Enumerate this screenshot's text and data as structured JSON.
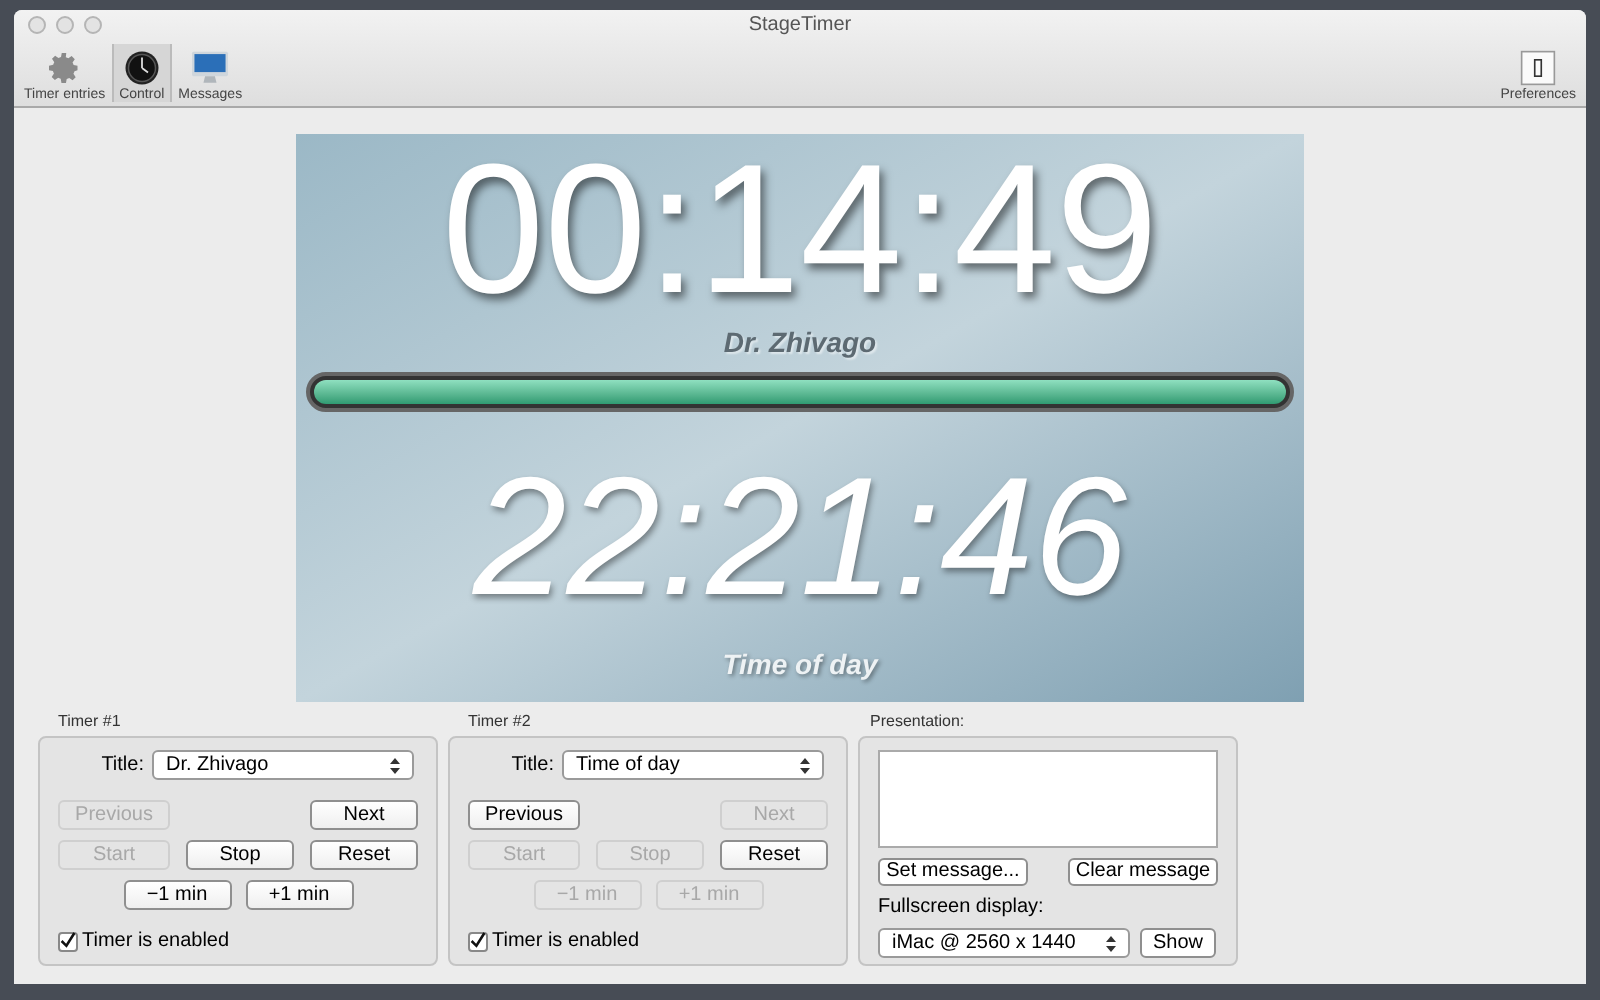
{
  "window": {
    "title": "StageTimer"
  },
  "toolbar": [
    {
      "label": "Timer entries",
      "kind": "gear",
      "selected": false
    },
    {
      "label": "Control",
      "kind": "clock",
      "selected": true
    },
    {
      "label": "Messages",
      "kind": "monitor",
      "selected": false
    },
    {
      "label": "Preferences",
      "kind": "switch",
      "selected": false
    }
  ],
  "preview": {
    "main_time": "00:14:49",
    "main_title": "Dr. Zhivago",
    "progress": {
      "level": 1.0
    },
    "second_time": "22:21:46",
    "second_title": "Time of day"
  },
  "timers": [
    {
      "heading": "Timer #1",
      "title_label": "Title:",
      "title_value": "Dr. Zhivago",
      "buttons": {
        "previous": {
          "label": "Previous",
          "disabled": true
        },
        "next": {
          "label": "Next",
          "disabled": false
        },
        "start": {
          "label": "Start",
          "disabled": true
        },
        "stop": {
          "label": "Stop",
          "disabled": false
        },
        "reset": {
          "label": "Reset",
          "disabled": false
        },
        "minus": {
          "label": "−1 min",
          "disabled": false
        },
        "plus": {
          "label": "+1 min",
          "disabled": false
        }
      },
      "enabled": {
        "label": "Timer is enabled",
        "checked": true
      }
    },
    {
      "heading": "Timer #2",
      "title_label": "Title:",
      "title_value": "Time of day",
      "buttons": {
        "previous": {
          "label": "Previous",
          "disabled": false
        },
        "next": {
          "label": "Next",
          "disabled": true
        },
        "start": {
          "label": "Start",
          "disabled": true
        },
        "stop": {
          "label": "Stop",
          "disabled": true
        },
        "reset": {
          "label": "Reset",
          "disabled": false
        },
        "minus": {
          "label": "−1 min",
          "disabled": true
        },
        "plus": {
          "label": "+1 min",
          "disabled": true
        }
      },
      "enabled": {
        "label": "Timer is enabled",
        "checked": true
      }
    }
  ],
  "presentation": {
    "heading": "Presentation:",
    "set_button": "Set message...",
    "clear_button": "Clear message",
    "display_label": "Fullscreen display:",
    "display_value": "iMac @ 2560 x 1440",
    "show_button": "Show"
  }
}
